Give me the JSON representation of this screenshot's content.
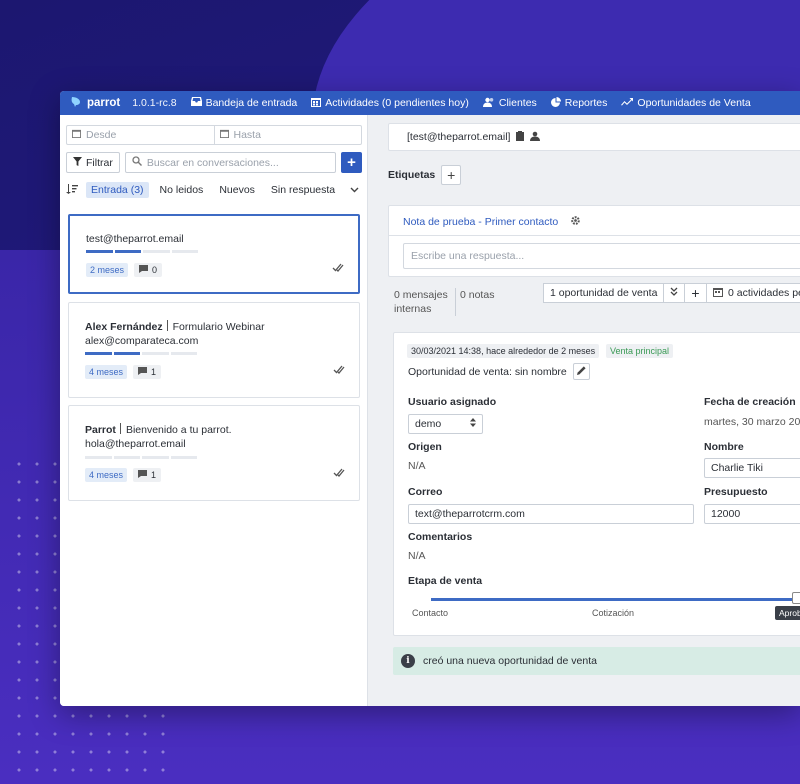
{
  "app": {
    "brand": "parrot",
    "version": "1.0.1-rc.8",
    "nav": [
      {
        "label": "Bandeja de entrada",
        "icon": "inbox-icon"
      },
      {
        "label": "Actividades (0 pendientes hoy)",
        "icon": "calendar-icon"
      },
      {
        "label": "Clientes",
        "icon": "users-icon"
      },
      {
        "label": "Reportes",
        "icon": "pie-chart-icon"
      },
      {
        "label": "Oportunidades de Venta",
        "icon": "trend-line-icon"
      }
    ],
    "accent_color": "#2f5bbf"
  },
  "left": {
    "date_from_placeholder": "Desde",
    "date_to_placeholder": "Hasta",
    "filter_label": "Filtrar",
    "search_placeholder": "Buscar en conversaciones...",
    "add_label": "+",
    "tabs": [
      "Entrada (3)",
      "No leidos",
      "Nuevos",
      "Sin respuesta"
    ],
    "conversations": [
      {
        "name": "",
        "subject": "",
        "email": "test@theparrot.email",
        "time": "2 meses",
        "count": "0",
        "selected": true
      },
      {
        "name": "Alex Fernández",
        "subject": "Formulario Webinar",
        "email": "alex@comparateca.com",
        "time": "4 meses",
        "count": "1",
        "selected": false
      },
      {
        "name": "Parrot",
        "subject": "Bienvenido a tu parrot.",
        "email": "hola@theparrot.email",
        "time": "4 meses",
        "count": "1",
        "selected": false
      }
    ]
  },
  "right": {
    "contact_email": "[test@theparrot.email]",
    "etiquetas_label": "Etiquetas",
    "note_title": "Nota de prueba - Primer contacto",
    "reply_placeholder": "Escribe una respuesta...",
    "messages_count": "0 mensajes internas",
    "messages_line1": "0 mensajes",
    "messages_line2": "internas",
    "notes_count": "0 notas",
    "opportunities_button": "1 oportunidad de venta",
    "activities_button": "0 actividades pe",
    "opportunity": {
      "timestamp": "30/03/2021 14:38, hace alrededor de 2 meses",
      "tag": "Venta principal",
      "title": "Oportunidad de venta: sin nombre",
      "assigned_label": "Usuario asignado",
      "assigned_value": "demo",
      "created_label": "Fecha de creación",
      "created_value": "martes, 30 marzo 20",
      "origin_label": "Origen",
      "origin_value": "N/A",
      "name_label": "Nombre",
      "name_value": "Charlie Tiki",
      "email_label": "Correo",
      "email_value": "text@theparrotcrm.com",
      "budget_label": "Presupuesto",
      "budget_value": "12000",
      "comments_label": "Comentarios",
      "comments_value": "N/A",
      "stage_label": "Etapa de venta",
      "stages": [
        "Contacto",
        "Cotización",
        "Aprob"
      ],
      "stage_progress": 0.98
    },
    "activity_text": "creó una nueva oportunidad de venta"
  }
}
